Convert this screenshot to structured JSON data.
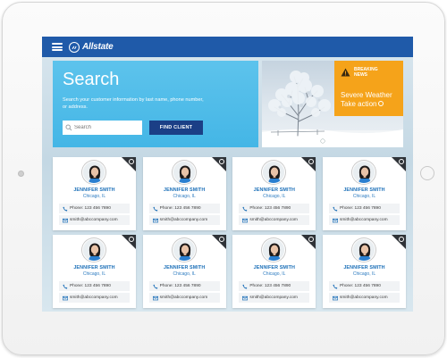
{
  "app": {
    "brand": "Allstate"
  },
  "search": {
    "title": "Search",
    "description": "Search your customer information by last name, phone number, or address.",
    "placeholder": "Search",
    "button_label": "FIND CLIENT"
  },
  "news": {
    "tag_line1": "BREAKING",
    "tag_line2": "NEWS",
    "headline_line1": "Severe Weather",
    "headline_line2": "Take action",
    "carousel_dots": 4,
    "active_dot": 0
  },
  "clients": [
    {
      "name": "JENNIFER SMITH",
      "city": "Chicago, IL",
      "phone": "Phone: 123 456 7890",
      "email": "smith@abccompany.com"
    },
    {
      "name": "JENNIFER SMITH",
      "city": "Chicago, IL",
      "phone": "Phone: 123 456 7890",
      "email": "smith@abccompany.com"
    },
    {
      "name": "JENNIFER SMITH",
      "city": "Chicago, IL",
      "phone": "Phone: 123 456 7890",
      "email": "smith@abccompany.com"
    },
    {
      "name": "JENNIFER SMITH",
      "city": "Chicago, IL",
      "phone": "Phone: 123 456 7890",
      "email": "smith@abccompany.com"
    },
    {
      "name": "JENNIFER SMITH",
      "city": "Chicago, IL",
      "phone": "Phone: 123 456 7890",
      "email": "smith@abccompany.com"
    },
    {
      "name": "JENNIFER SMITH",
      "city": "Chicago, IL",
      "phone": "Phone: 123 456 7890",
      "email": "smith@abccompany.com"
    },
    {
      "name": "JENNIFER SMITH",
      "city": "Chicago, IL",
      "phone": "Phone: 123 456 7890",
      "email": "smith@abccompany.com"
    },
    {
      "name": "JENNIFER SMITH",
      "city": "Chicago, IL",
      "phone": "Phone: 123 456 7890",
      "email": "smith@abccompany.com"
    }
  ],
  "icons": {
    "menu": "hamburger-menu-icon",
    "logo": "allstate-hands-logo",
    "search": "search-icon",
    "warning": "warning-triangle-icon",
    "info": "info-icon",
    "phone": "phone-icon",
    "email": "envelope-icon"
  },
  "colors": {
    "topbar": "#1f5aa9",
    "search_panel": "#4dbbe9",
    "find_button": "#1b3f86",
    "news_box": "#f5a31a",
    "client_name": "#1b6fb8",
    "card_corner": "#2f3338"
  }
}
